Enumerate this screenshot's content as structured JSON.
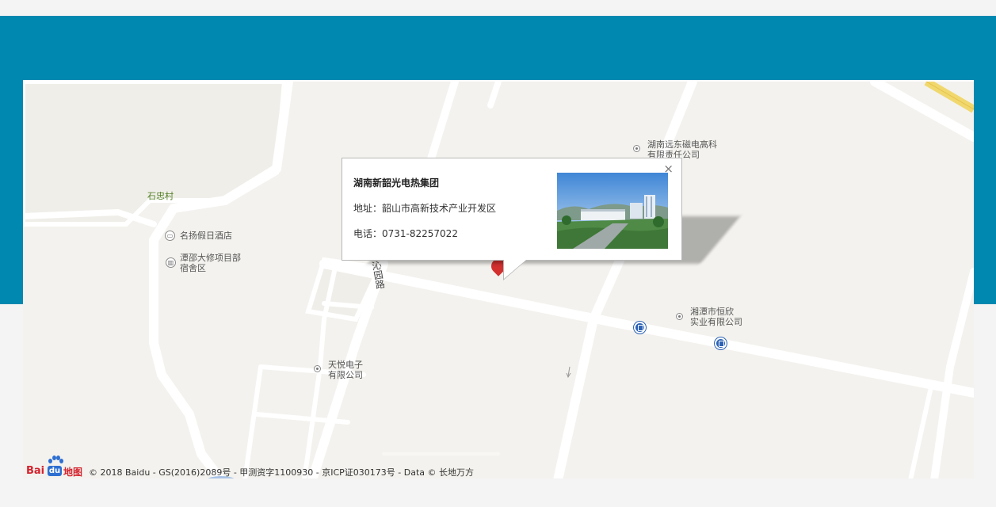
{
  "popup": {
    "title": "湖南新韶光电热集团",
    "address": "地址：韶山市高新技术产业开发区",
    "phone": "电话：0731-82257022",
    "close_glyph": "×"
  },
  "map_labels": {
    "road_qinyuan": "沁园路",
    "village": "石忠村",
    "hotel": "名扬假日酒店",
    "dorm_line1": "潭邵大修项目部",
    "dorm_line2": "宿舍区",
    "company_yuandong_line1": "湖南远东磁电高科",
    "company_yuandong_line2": "有限责任公司",
    "company_hengxin_line1": "湘潭市恒欣",
    "company_hengxin_line2": "实业有限公司",
    "company_tianyue_line1": "天悦电子",
    "company_tianyue_line2": "有限公司"
  },
  "attribution": {
    "logo_bai": "Bai",
    "logo_du": "du",
    "logo_ditu": "地图",
    "copyright": "© 2018 Baidu - GS(2016)2089号 - 甲测资字1100930 - 京ICP证030173号 - Data © 长地万方"
  },
  "colors": {
    "band_blue": "#0088b0",
    "map_bg": "#f3f2ee",
    "road": "#ffffff",
    "marker_red": "#d32f2f",
    "bus_blue": "#2a62b6"
  },
  "icons": {
    "hotel": "bed-icon",
    "dorm": "building-icon",
    "company": "poi-dot-icon",
    "bus": "bus-stop-icon",
    "marker": "map-pin-icon",
    "close": "close-icon"
  }
}
